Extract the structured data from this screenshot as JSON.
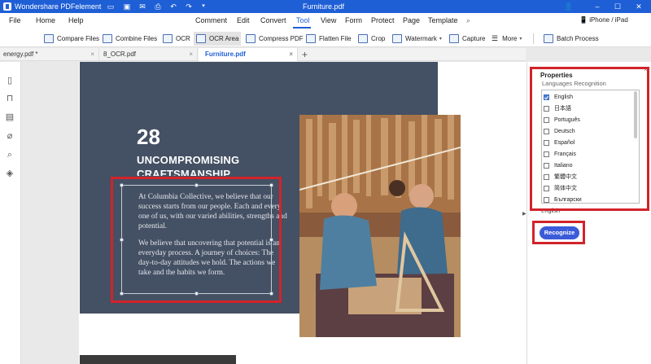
{
  "titlebar": {
    "app_name": "Wondershare PDFelement",
    "doc_title": "Furniture.pdf",
    "quick_icons": [
      "folder-icon",
      "save-icon",
      "mail-icon",
      "print-icon",
      "undo-icon",
      "redo-icon",
      "dropdown-icon"
    ],
    "window_controls": {
      "account": "👤",
      "minimize": "–",
      "maximize": "☐",
      "close": "✕"
    }
  },
  "menubar": {
    "left": [
      "File",
      "Home",
      "Help"
    ],
    "main": [
      "Comment",
      "Edit",
      "Convert",
      "Tool",
      "View",
      "Form",
      "Protect",
      "Page",
      "Template"
    ],
    "active": "Tool",
    "device": "iPhone / iPad"
  },
  "toolbar": {
    "items": [
      "Compare Files",
      "Combine Files",
      "OCR",
      "OCR Area",
      "Compress PDF",
      "Flatten File",
      "Crop",
      "Watermark",
      "Capture",
      "More",
      "Batch Process"
    ],
    "selected": "OCR Area"
  },
  "tabs": [
    {
      "label": "energy.pdf *",
      "active": false
    },
    {
      "label": "8_OCR.pdf",
      "active": false
    },
    {
      "label": "Furniture.pdf",
      "active": true
    }
  ],
  "document": {
    "number": "28",
    "heading_line1": "UNCOMPROMISING",
    "heading_line2": "CRAFTSMANSHIP",
    "paragraph1": "At Columbia Collective, we believe that our success starts from our people. Each and every one of us, with our varied abilities, strengths and potential.",
    "paragraph2": "We believe that uncovering that potential is an everyday process. A journey of choices: The day-to-day attitudes we hold. The actions we take and the habits we form."
  },
  "properties": {
    "title": "Properties",
    "subtitle": "Languages Recognition",
    "languages": [
      {
        "name": "English",
        "checked": true
      },
      {
        "name": "日本語",
        "checked": false
      },
      {
        "name": "Português",
        "checked": false
      },
      {
        "name": "Deutsch",
        "checked": false
      },
      {
        "name": "Español",
        "checked": false
      },
      {
        "name": "Français",
        "checked": false
      },
      {
        "name": "Italiano",
        "checked": false
      },
      {
        "name": "繁體中文",
        "checked": false
      },
      {
        "name": "简体中文",
        "checked": false
      },
      {
        "name": "Български",
        "checked": false
      }
    ],
    "selected_summary": "English",
    "recognize_label": "Recognize"
  },
  "colors": {
    "accent": "#1f5fd6",
    "highlight": "#d2232a",
    "panel_dark": "#445063",
    "button": "#3b5bd9"
  }
}
